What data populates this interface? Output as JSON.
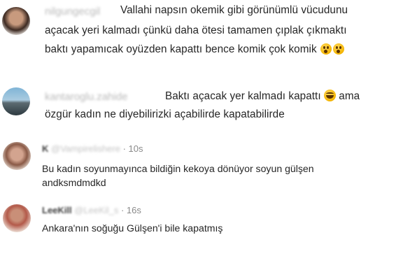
{
  "comments": [
    {
      "username": "nilgungecgil",
      "lines": [
        "Vallahi napsın okemik gibi görünümlü vücudunu",
        "açacak yeri kalmadı çünkü daha ötesi tamamen çıplak çıkmaktı",
        "baktı yapamıcak oyüzden kapattı bence komik çok komik"
      ],
      "emojis": [
        "astonished-face-icon",
        "astonished-face-icon"
      ]
    },
    {
      "username": "kantaroglu.zahide",
      "lines": [
        "Baktı açacak yer kalmadı kapattı",
        "ama",
        "özgür kadın ne diyebilirizki açabilirde kapatabilirde"
      ],
      "emojis": [
        "laughing-tears-face-icon"
      ]
    },
    {
      "display_name": "K",
      "handle": "@Vampirelishere",
      "time": "· 10s",
      "lines": [
        "Bu kadın soyunmayınca bildiğin kekoya dönüyor soyun gülşen",
        "andksmdmdkd"
      ]
    },
    {
      "display_name": "LeeKill",
      "handle": "@LeeKil_s",
      "time": "· 16s",
      "lines": [
        "Ankara'nın soğuğu Gülşen'i bile kapatmış"
      ]
    }
  ],
  "colors": {
    "text": "#262626",
    "muted": "#8a8a8a",
    "emoji": "#f4b400"
  }
}
